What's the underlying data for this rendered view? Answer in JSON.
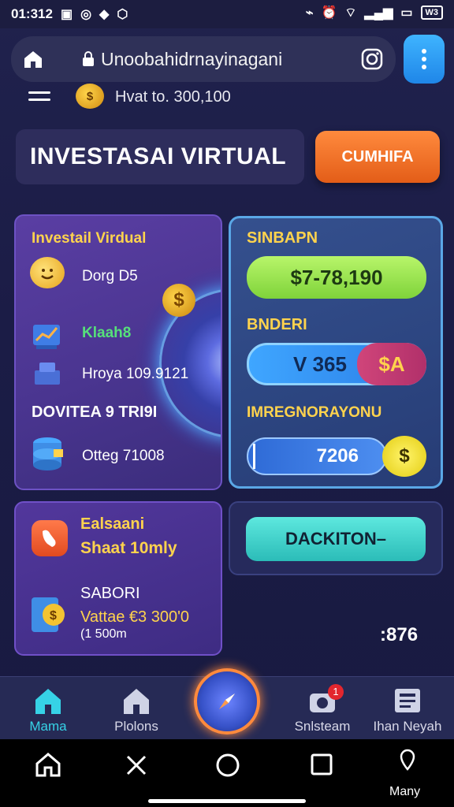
{
  "status_bar": {
    "time": "01:312",
    "battery": "W3"
  },
  "browser": {
    "url": "Unoobahidrnayinagani"
  },
  "header": {
    "balance": "Hvat to. 300,100",
    "coin_symbol": "$"
  },
  "title": {
    "text": "INVESTASAI VIRTUAL",
    "cta_label": "CUMHIFA"
  },
  "left_card": {
    "title": "Investail Virdual",
    "rows": [
      {
        "icon": "smiley-coin-icon",
        "label": "Dorg D5"
      },
      {
        "icon": "chart-icon",
        "label": "Klaah8",
        "color": "#56e07a"
      },
      {
        "icon": "",
        "label": "Hroya 109.9121"
      }
    ],
    "section_title": "DOVITEA 9 TRI9I",
    "data_row": {
      "icon": "database-icon",
      "label": "Otteg 71008"
    }
  },
  "right_card": {
    "label1": "SINBAPN",
    "value1": "$7-78,190",
    "label2": "BNDERI",
    "value2": "V 365",
    "badge2": "$A",
    "label3": "IMREGNORAYONU",
    "value3": "7206",
    "badge3": "$"
  },
  "bottom_left": {
    "title": "Ealsaani",
    "subtitle": "Shaat 10mly",
    "label": "SABORI",
    "value": "Vattae €3 300'0",
    "sub_value": "(1 500m"
  },
  "bottom_right": {
    "button_label": "DACKITON–",
    "stat": ":876"
  },
  "tabs": [
    {
      "label": "Mama",
      "active": true
    },
    {
      "label": "Plolons",
      "active": false
    },
    {
      "label": "Snlsteam",
      "badge": "1",
      "active": false
    },
    {
      "label": "Ihan Neyah",
      "active": false
    }
  ],
  "nav": {
    "last_label": "Many"
  },
  "colors": {
    "accent_orange": "#e35d18",
    "accent_teal": "#2bbcb8",
    "active_tab": "#36d2e6",
    "gold": "#ffd34d"
  }
}
